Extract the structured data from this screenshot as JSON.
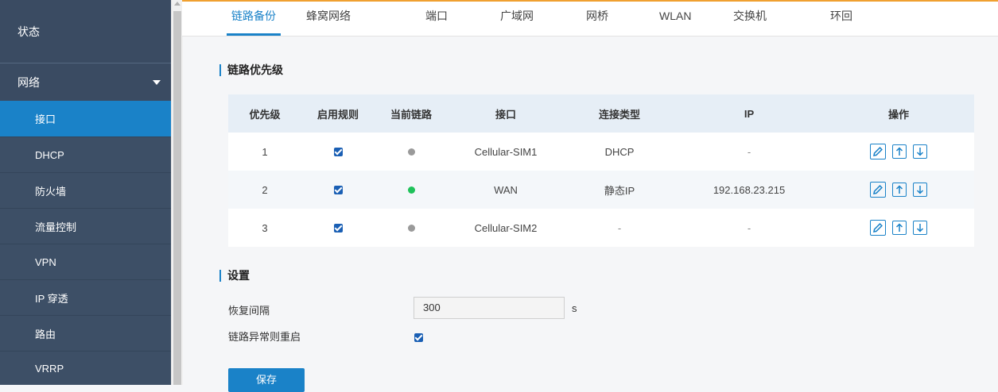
{
  "sidebar": {
    "status": "状态",
    "network": "网络",
    "items": [
      "接口",
      "DHCP",
      "防火墙",
      "流量控制",
      "VPN",
      "IP 穿透",
      "路由",
      "VRRP"
    ]
  },
  "tabs": [
    "链路备份",
    "蜂窝网络",
    "端口",
    "广域网",
    "网桥",
    "WLAN",
    "交换机",
    "环回"
  ],
  "active_tab": "链路备份",
  "priority_section": {
    "title": "链路优先级",
    "columns": [
      "优先级",
      "启用规则",
      "当前链路",
      "接口",
      "连接类型",
      "IP",
      "操作"
    ],
    "rows": [
      {
        "priority": "1",
        "enabled": true,
        "current_link": "gray",
        "interface": "Cellular-SIM1",
        "conn_type": "DHCP",
        "ip": "-"
      },
      {
        "priority": "2",
        "enabled": true,
        "current_link": "green",
        "interface": "WAN",
        "conn_type": "静态IP",
        "ip": "192.168.23.215"
      },
      {
        "priority": "3",
        "enabled": true,
        "current_link": "gray",
        "interface": "Cellular-SIM2",
        "conn_type": "-",
        "ip": "-"
      }
    ]
  },
  "settings": {
    "title": "设置",
    "recovery_label": "恢复间隔",
    "recovery_value": "300",
    "recovery_unit": "s",
    "reboot_label": "链路异常则重启",
    "reboot_checked": true
  },
  "save_label": "保存",
  "colors": {
    "accent": "#1a82c8",
    "sidebar": "#3d4f66",
    "active_link": "#1fc25a",
    "inactive_link": "#9a9a9a",
    "top_line": "#f0a030"
  }
}
